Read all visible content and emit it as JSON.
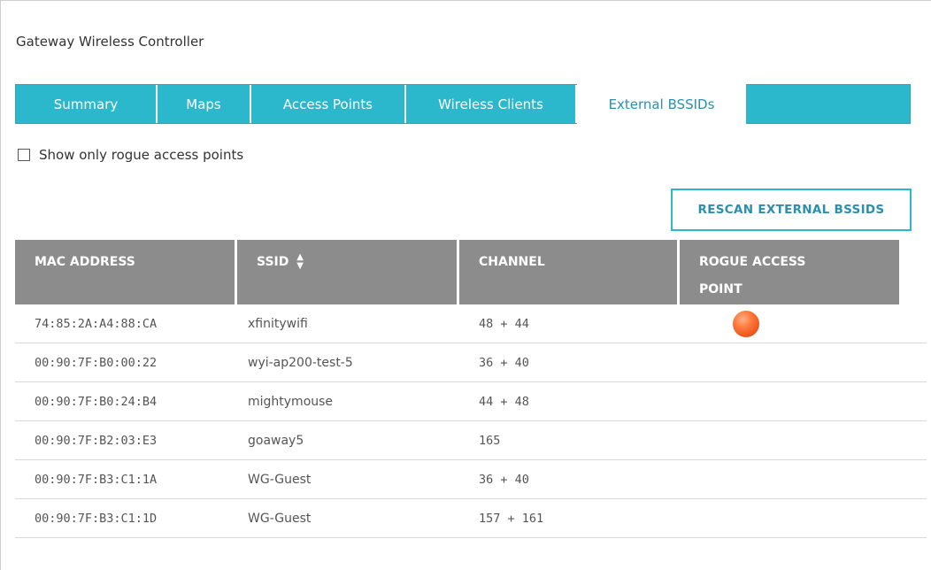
{
  "app": {
    "title": "Gateway Wireless Controller"
  },
  "tabs": [
    {
      "label": "Summary",
      "active": false
    },
    {
      "label": "Maps",
      "active": false
    },
    {
      "label": "Access Points",
      "active": false
    },
    {
      "label": "Wireless Clients",
      "active": false
    },
    {
      "label": "External BSSIDs",
      "active": true
    }
  ],
  "filter": {
    "rogue_only_label": "Show only rogue access points",
    "checked": false
  },
  "actions": {
    "rescan_label": "RESCAN EXTERNAL BSSIDS"
  },
  "table": {
    "columns": [
      {
        "label": "MAC ADDRESS"
      },
      {
        "label": "SSID"
      },
      {
        "label": "CHANNEL"
      },
      {
        "label": "ROGUE ACCESS POINT"
      }
    ],
    "rows": [
      {
        "mac": "74:85:2A:A4:88:CA",
        "ssid": "xfinitywifi",
        "channel": "48 + 44",
        "rogue": true
      },
      {
        "mac": "00:90:7F:B0:00:22",
        "ssid": "wyi-ap200-test-5",
        "channel": "36 + 40",
        "rogue": false
      },
      {
        "mac": "00:90:7F:B0:24:B4",
        "ssid": "mightymouse",
        "channel": "44 + 48",
        "rogue": false
      },
      {
        "mac": "00:90:7F:B2:03:E3",
        "ssid": "goaway5",
        "channel": "165",
        "rogue": false
      },
      {
        "mac": "00:90:7F:B3:C1:1A",
        "ssid": "WG-Guest",
        "channel": "36 + 40",
        "rogue": false
      },
      {
        "mac": "00:90:7F:B3:C1:1D",
        "ssid": "WG-Guest",
        "channel": "157 + 161",
        "rogue": false
      }
    ]
  },
  "colors": {
    "accent": "#2bb8cc",
    "header_gray": "#8c8c8c",
    "rogue_indicator": "#ff7a3d"
  },
  "icons": {
    "sort": "sort-updown-icon",
    "rogue": "rogue-indicator-icon"
  }
}
